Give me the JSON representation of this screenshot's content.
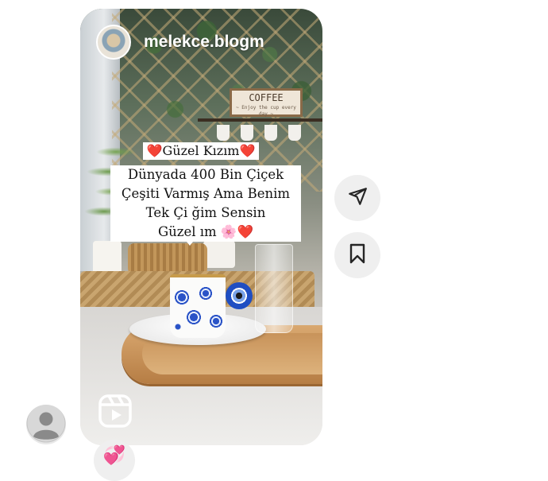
{
  "post": {
    "username": "melekce.blogm",
    "sign_text": "COFFEE",
    "sign_subtext": "~ Enjoy the cup every day ~",
    "caption_title": "❤️Güzel Kızım❤️",
    "caption_lines": [
      "Dünyada 400 Bin Çiçek",
      "Çeşiti Varmış Ama Benim",
      "Tek Çi  ğim Sensin",
      "Güzel   ım 🌸❤️"
    ]
  },
  "actions": {
    "share_icon": "send-icon",
    "save_icon": "bookmark-icon",
    "reel_icon": "reels-icon"
  },
  "reaction": {
    "emoji": "💞"
  },
  "colors": {
    "button_bg": "#efefef",
    "icon": "#262626"
  }
}
